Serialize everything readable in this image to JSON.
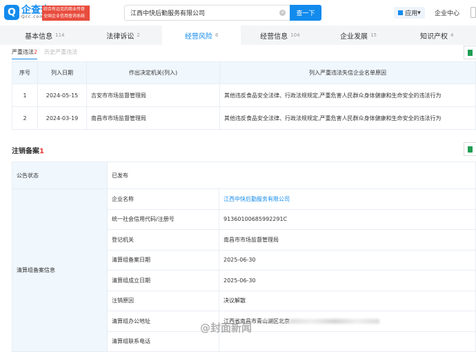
{
  "header": {
    "logo_cn": "企查查",
    "logo_en": "Qcc.com",
    "slogan_line1": "综合有远见的商业传奇",
    "slogan_line2": "全国企业信用查询系统",
    "search_value": "江西中快后勤服务有限公司",
    "search_button": "查一下",
    "apps": "应用",
    "enterprise_center": "企业中心"
  },
  "tabs": [
    {
      "label": "基本信息",
      "count": "114"
    },
    {
      "label": "法律诉讼",
      "count": "2"
    },
    {
      "label": "经营风险",
      "count": "6"
    },
    {
      "label": "经营信息",
      "count": "104"
    },
    {
      "label": "企业发展",
      "count": "15"
    },
    {
      "label": "知识产权",
      "count": "4"
    }
  ],
  "subtabs": {
    "active_label": "严重违法",
    "active_count": "2",
    "other": "历史严重违法"
  },
  "violations": {
    "headers": [
      "序号",
      "列入日期",
      "作出决定机关(列入)",
      "列入严重违法失信企业名单原因"
    ],
    "rows": [
      [
        "1",
        "2024-05-15",
        "吉安市市场监督管理局",
        "其他违反食品安全法律、行政法规规定,严重危害人民群众身体健康和生命安全的违法行为"
      ],
      [
        "2",
        "2024-03-19",
        "南昌市市场监督管理局",
        "其他违反食品安全法律、行政法规规定,严重危害人民群众身体健康和生命安全的违法行为"
      ]
    ]
  },
  "cancellation": {
    "title": "注销备案",
    "count": "1",
    "status_label": "公告状态",
    "status_value": "已发布",
    "group_label": "清算组备案信息",
    "rows": [
      {
        "label": "企业名称",
        "value": "江西中快后勤服务有限公司"
      },
      {
        "label": "统一社会信用代码/注册号",
        "value": "91360100685992291C"
      },
      {
        "label": "登记机关",
        "value": "南昌市市场监督管理局"
      },
      {
        "label": "清算组备案日期",
        "value": "2025-06-30"
      },
      {
        "label": "清算组成立日期",
        "value": "2025-06-30"
      },
      {
        "label": "注销原因",
        "value": "决议解散"
      },
      {
        "label": "清算组办公地址",
        "value": "江西省南昌市青山湖区北京"
      },
      {
        "label": "清算组联系电话",
        "value": ""
      }
    ]
  },
  "watermark": "@封面新闻"
}
